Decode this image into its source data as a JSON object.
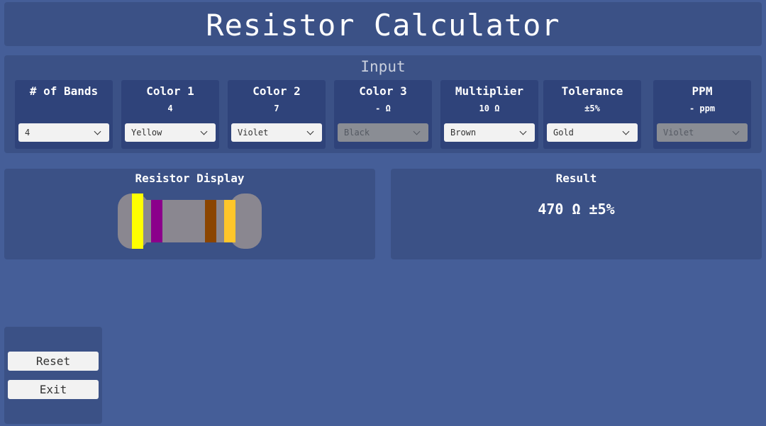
{
  "app": {
    "title": "Resistor Calculator"
  },
  "input": {
    "title": "Input",
    "fields": [
      {
        "label": "# of Bands",
        "value": "",
        "selected": "4",
        "disabled": false
      },
      {
        "label": "Color 1",
        "value": "4",
        "selected": "Yellow",
        "disabled": false
      },
      {
        "label": "Color 2",
        "value": "7",
        "selected": "Violet",
        "disabled": false
      },
      {
        "label": "Color 3",
        "value": "- Ω",
        "selected": "Black",
        "disabled": true
      },
      {
        "label": "Multiplier",
        "value": "10 Ω",
        "selected": "Brown",
        "disabled": false
      },
      {
        "label": "Tolerance",
        "value": "±5%",
        "selected": "Gold",
        "disabled": false
      },
      {
        "label": "PPM",
        "value": "- ppm",
        "selected": "Violet",
        "disabled": true
      }
    ]
  },
  "display": {
    "title": "Resistor Display",
    "body_color": "#8a8790",
    "bands": [
      {
        "name": "color-1",
        "color": "#ffff00"
      },
      {
        "name": "color-2",
        "color": "#8b008b"
      },
      {
        "name": "multiplier",
        "color": "#8b4500"
      },
      {
        "name": "tolerance",
        "color": "#ffc62a"
      }
    ]
  },
  "result": {
    "title": "Result",
    "text": "470 Ω ±5%"
  },
  "buttons": {
    "reset": "Reset",
    "exit": "Exit"
  }
}
